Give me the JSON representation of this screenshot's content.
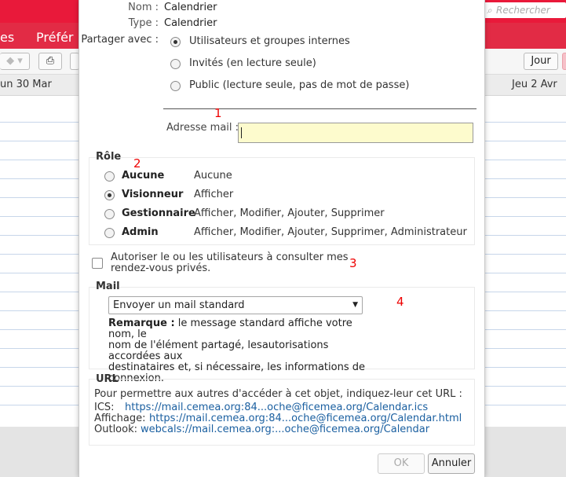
{
  "background": {
    "menu_items": [
      "es",
      "Préfér"
    ],
    "search_placeholder": "Rechercher",
    "toolbar": {
      "day_button": "Jour"
    },
    "day_headers": [
      "un 30 Mar",
      "Jeu 2 Avr"
    ]
  },
  "dialog": {
    "name_label": "Nom :",
    "name_value": "Calendrier",
    "type_label": "Type :",
    "type_value": "Calendrier",
    "share_label": "Partager avec :",
    "share_options": [
      {
        "label": "Utilisateurs et groupes internes",
        "selected": true
      },
      {
        "label": "Invités (en lecture seule)",
        "selected": false
      },
      {
        "label": "Public (lecture seule, pas de mot de passe)",
        "selected": false
      }
    ],
    "email_label": "Adresse mail :",
    "email_value": "",
    "annotations": [
      "1",
      "2",
      "3",
      "4"
    ],
    "role": {
      "legend": "Rôle",
      "options": [
        {
          "name": "Aucune",
          "description": "Aucune",
          "selected": false
        },
        {
          "name": "Visionneur",
          "description": "Afficher",
          "selected": true
        },
        {
          "name": "Gestionnaire",
          "description": "Afficher, Modifier, Ajouter, Supprimer",
          "selected": false
        },
        {
          "name": "Admin",
          "description": "Afficher, Modifier, Ajouter, Supprimer, Administrateur",
          "selected": false
        }
      ]
    },
    "private_checkbox": {
      "line1": "Autoriser le ou les utilisateurs à consulter mes",
      "line2": "rendez-vous privés.",
      "checked": false
    },
    "mail": {
      "legend": "Mail",
      "select_value": "Envoyer un mail standard",
      "note_bold": "Remarque :",
      "note_lines": [
        " le message standard affiche votre nom, le",
        "nom de l'élément partagé, lesautorisations accordées aux",
        "destinataires et, si nécessaire, les informations de",
        "connexion."
      ]
    },
    "url": {
      "legend": "URL",
      "intro": "Pour permettre aux autres d'accéder à cet objet, indiquez-leur cet URL :",
      "ics_label": "ICS:",
      "ics_link": "https://mail.cemea.org:84...oche@ficemea.org/Calendar.ics",
      "affichage_label": "Affichage:",
      "affichage_link": "https://mail.cemea.org:84...oche@ficemea.org/Calendar.html",
      "outlook_label": "Outlook:",
      "outlook_link": "webcals://mail.cemea.org:...oche@ficemea.org/Calendar"
    },
    "ok_label": "OK",
    "cancel_label": "Annuler"
  }
}
